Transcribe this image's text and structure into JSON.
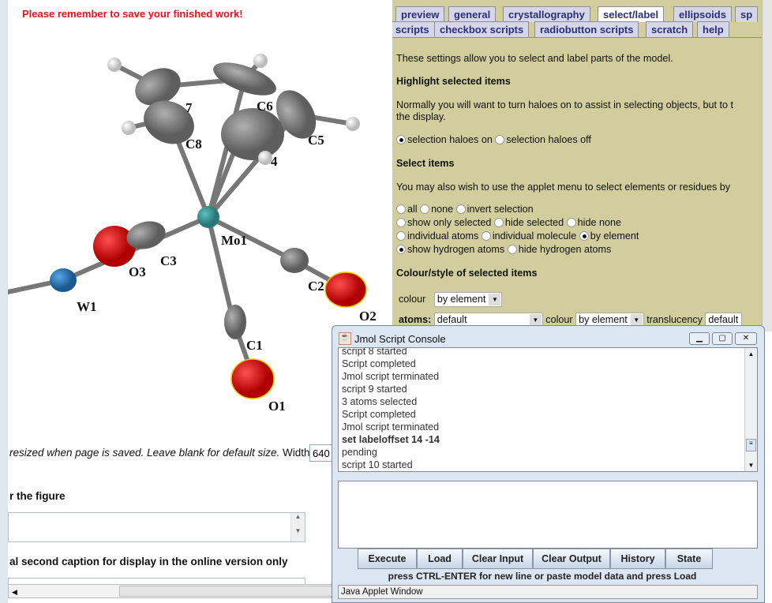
{
  "page": {
    "reminder": "Please remember to save your finished work!",
    "size_text_italic": "resized when page is saved. Leave blank for default size.",
    "width_label": "Width:",
    "width_value": "640",
    "caption_heading": "r the figure",
    "second_caption_heading": "al second caption for display in the online version only"
  },
  "molecule": {
    "labels": [
      "7",
      "C6",
      "C8",
      "C5",
      "4",
      "Mo1",
      "C3",
      "O3",
      "W1",
      "C2",
      "O2",
      "C1",
      "O1"
    ],
    "colors": {
      "carbon": "#7c7c7c",
      "oxygen": "#e00000",
      "molybdenum": "#3a9c9c",
      "tungsten": "#2a7ab8",
      "hydrogen": "#f4f4f4"
    }
  },
  "panel": {
    "tabs_row1": [
      "preview",
      "general",
      "crystallography",
      "select/label",
      "ellipsoids",
      "sp"
    ],
    "tabs_row2": [
      "scripts",
      "checkbox scripts",
      "radiobutton scripts",
      "scratch",
      "help"
    ],
    "active_tab": "select/label",
    "intro": "These settings allow you to select and label parts of the model.",
    "h_highlight": "Highlight selected items",
    "highlight_text1": "Normally you will want to turn haloes on to assist in selecting objects, but to t",
    "highlight_text2": "the display.",
    "halo_on": "selection haloes on",
    "halo_off": "selection haloes off",
    "h_select": "Select items",
    "select_text": "You may also wish to use the applet menu to select elements or residues by",
    "r_all": "all",
    "r_none": "none",
    "r_invert": "invert selection",
    "r_show_only": "show only selected",
    "r_hide_sel": "hide selected",
    "r_hide_none": "hide none",
    "r_ind_atoms": "individual atoms",
    "r_ind_mol": "individual molecule",
    "r_by_el": "by element",
    "r_show_h": "show hydrogen atoms",
    "r_hide_h": "hide hydrogen atoms",
    "h_colour": "Colour/style of selected items",
    "colour_label": "colour",
    "colour_value": "by element",
    "atoms_label": "atoms:",
    "atoms_value": "default",
    "atoms_colour_label": "colour",
    "atoms_colour_value": "by element",
    "translucency_label": "translucency",
    "translucency_value": "default"
  },
  "console": {
    "title": "Jmol Script Console",
    "output": [
      "script 8 started",
      "Script completed",
      "Jmol script terminated",
      "script 9 started",
      "3 atoms selected",
      "Script completed",
      "Jmol script terminated",
      "set labeloffset 14 -14",
      "pending",
      "script 10 started"
    ],
    "buttons": [
      "Execute",
      "Load",
      "Clear Input",
      "Clear Output",
      "History",
      "State"
    ],
    "hint": "press CTRL-ENTER for new line or paste model data and press Load",
    "status": "Java Applet Window"
  }
}
